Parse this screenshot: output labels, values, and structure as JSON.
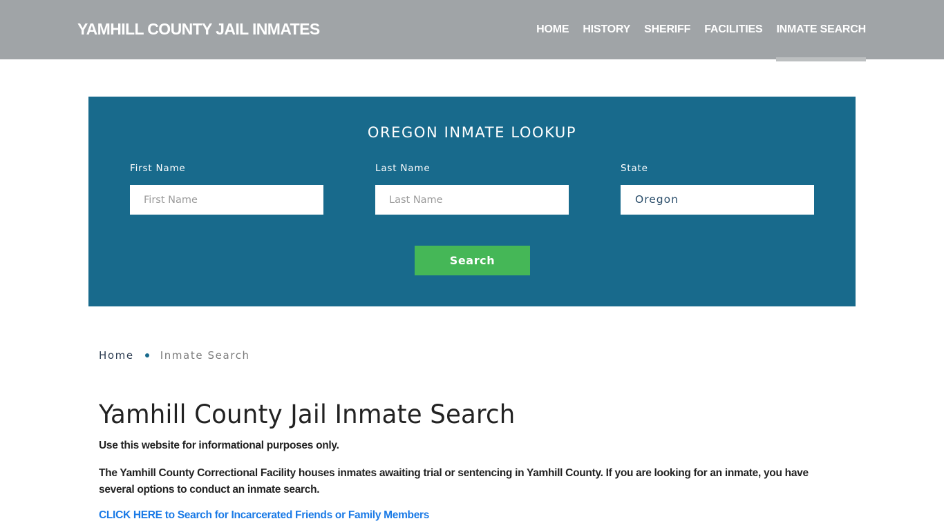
{
  "header": {
    "site_title": "YAMHILL COUNTY JAIL INMATES",
    "nav": [
      {
        "label": "HOME",
        "active": false
      },
      {
        "label": "HISTORY",
        "active": false
      },
      {
        "label": "SHERIFF",
        "active": false
      },
      {
        "label": "FACILITIES",
        "active": false
      },
      {
        "label": "INMATE SEARCH",
        "active": true
      }
    ]
  },
  "lookup": {
    "title": "OREGON INMATE LOOKUP",
    "first_name": {
      "label": "First Name",
      "placeholder": "First Name",
      "value": ""
    },
    "last_name": {
      "label": "Last Name",
      "placeholder": "Last Name",
      "value": ""
    },
    "state": {
      "label": "State",
      "value": "Oregon"
    },
    "search_label": "Search",
    "colors": {
      "panel": "#186a8c",
      "button": "#45b757"
    }
  },
  "breadcrumb": {
    "home": "Home",
    "current": "Inmate Search"
  },
  "content": {
    "title": "Yamhill County Jail Inmate Search",
    "paragraph1": "Use this website for informational purposes only.",
    "paragraph2": "The Yamhill County Correctional Facility houses inmates awaiting trial or sentencing in Yamhill County. If you are looking for an inmate, you have several options to conduct an inmate search.",
    "cta_link": "CLICK HERE to Search for Incarcerated Friends or Family Members"
  }
}
